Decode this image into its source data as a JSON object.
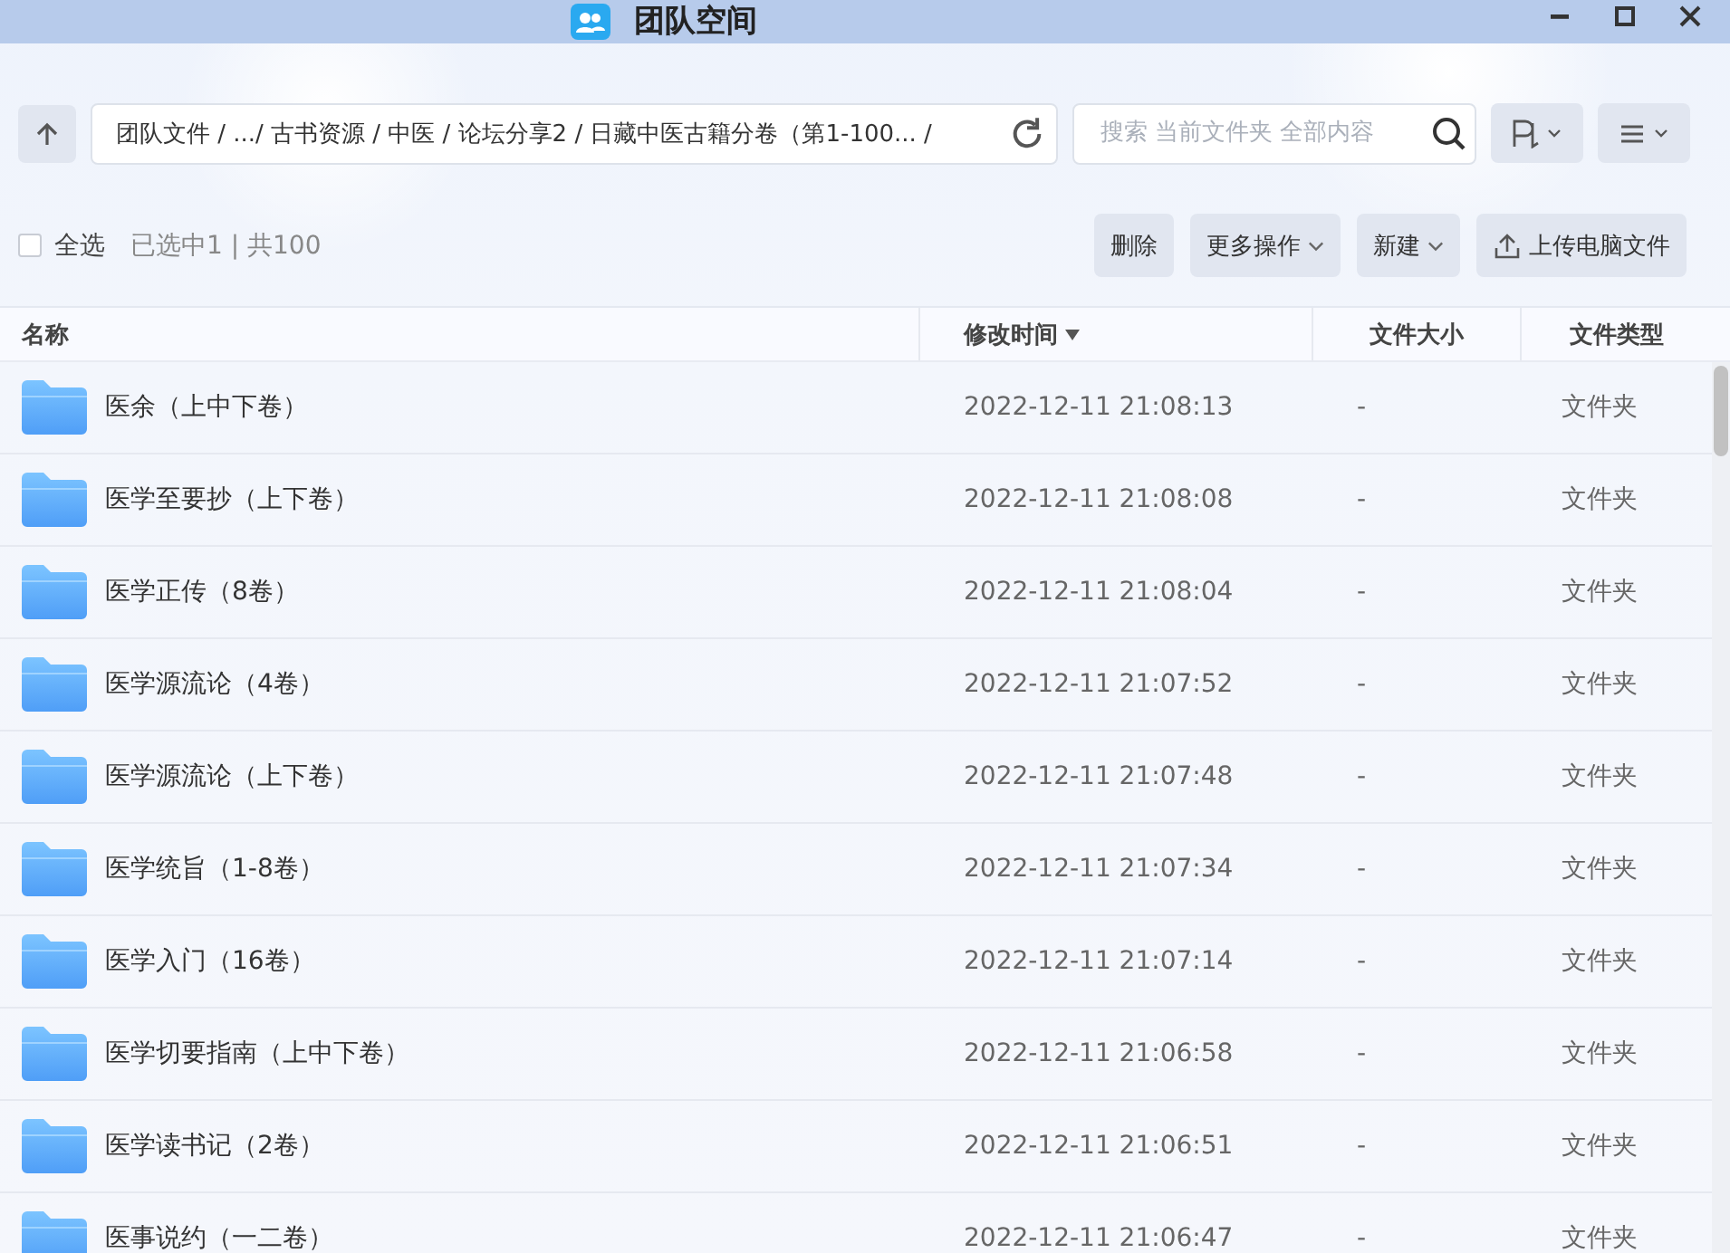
{
  "window": {
    "title": "团队空间"
  },
  "toolbar": {
    "path": "团队文件 / .../ 古书资源 / 中医 / 论坛分享2 / 日藏中医古籍分卷（第1-100... /",
    "search": {
      "placeholder": "搜索 当前文件夹 全部内容"
    }
  },
  "selection": {
    "select_all": {
      "label": "全选",
      "checked": false
    },
    "summary": "已选中1 | 共100"
  },
  "actions": [
    {
      "label": "删除",
      "dropdown": false,
      "kind": "plain"
    },
    {
      "label": "更多操作",
      "dropdown": true,
      "kind": "plain"
    },
    {
      "label": "新建",
      "dropdown": true,
      "kind": "plain"
    },
    {
      "label": "上传电脑文件",
      "dropdown": false,
      "kind": "upload"
    }
  ],
  "table": {
    "columns": [
      {
        "label": "名称",
        "sorted": false
      },
      {
        "label": "修改时间",
        "sorted": true
      },
      {
        "label": "文件大小",
        "sorted": false
      },
      {
        "label": "文件类型",
        "sorted": false
      }
    ],
    "rows": [
      {
        "name": "医余（上中下卷）",
        "modified": "2022-12-11 21:08:13",
        "size": "-",
        "type": "文件夹"
      },
      {
        "name": "医学至要抄（上下卷）",
        "modified": "2022-12-11 21:08:08",
        "size": "-",
        "type": "文件夹"
      },
      {
        "name": "医学正传（8卷）",
        "modified": "2022-12-11 21:08:04",
        "size": "-",
        "type": "文件夹"
      },
      {
        "name": "医学源流论（4卷）",
        "modified": "2022-12-11 21:07:52",
        "size": "-",
        "type": "文件夹"
      },
      {
        "name": "医学源流论（上下卷）",
        "modified": "2022-12-11 21:07:48",
        "size": "-",
        "type": "文件夹"
      },
      {
        "name": "医学统旨（1-8卷）",
        "modified": "2022-12-11 21:07:34",
        "size": "-",
        "type": "文件夹"
      },
      {
        "name": "医学入门（16卷）",
        "modified": "2022-12-11 21:07:14",
        "size": "-",
        "type": "文件夹"
      },
      {
        "name": "医学切要指南（上中下卷）",
        "modified": "2022-12-11 21:06:58",
        "size": "-",
        "type": "文件夹"
      },
      {
        "name": "医学读书记（2卷）",
        "modified": "2022-12-11 21:06:51",
        "size": "-",
        "type": "文件夹"
      },
      {
        "name": "医事说约（一二卷）",
        "modified": "2022-12-11 21:06:47",
        "size": "-",
        "type": "文件夹"
      }
    ]
  }
}
